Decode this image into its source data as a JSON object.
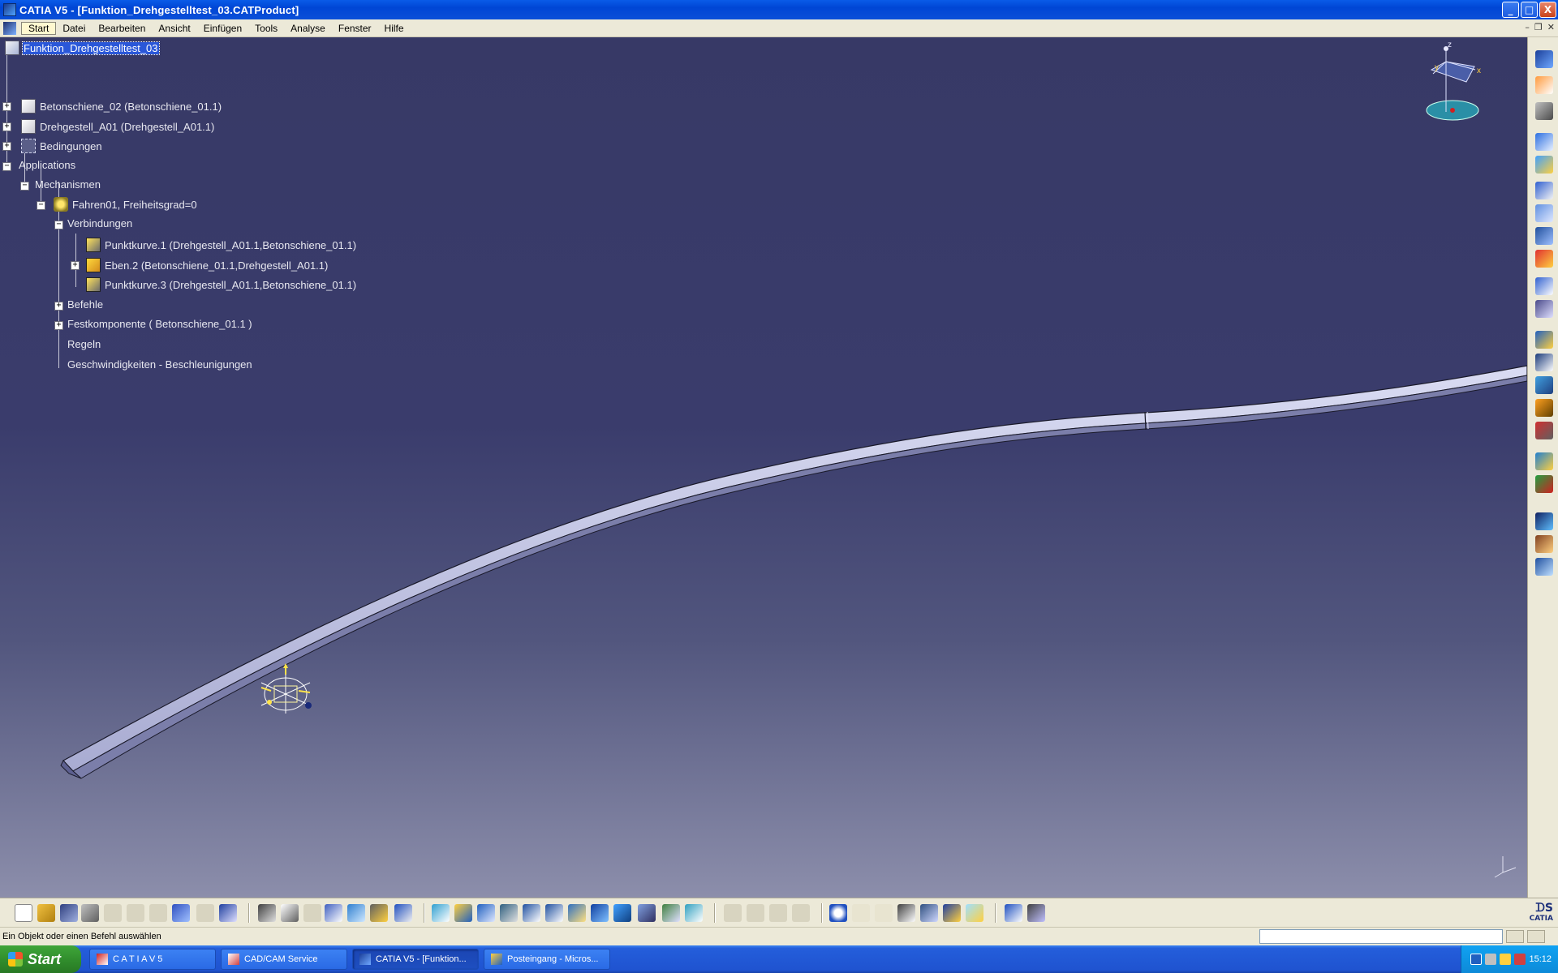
{
  "window": {
    "title": "CATIA V5 - [Funktion_Drehgestelltest_03.CATProduct]",
    "buttons": {
      "minimize": "_",
      "maximize": "□",
      "close": "X"
    }
  },
  "menu": {
    "items": [
      "Start",
      "Datei",
      "Bearbeiten",
      "Ansicht",
      "Einfügen",
      "Tools",
      "Analyse",
      "Fenster",
      "Hilfe"
    ]
  },
  "tree": {
    "root": "Funktion_Drehgestelltest_03",
    "product1": "Betonschiene_02 (Betonschiene_01.1)",
    "product2": "Drehgestell_A01 (Drehgestell_A01.1)",
    "constraints": "Bedingungen",
    "applications": "Applications",
    "mechanisms": "Mechanismen",
    "mechanism1": "Fahren01, Freiheitsgrad=0",
    "joints": "Verbindungen",
    "joint1": "Punktkurve.1 (Drehgestell_A01.1,Betonschiene_01.1)",
    "joint2": "Eben.2 (Betonschiene_01.1,Drehgestell_A01.1)",
    "joint3": "Punktkurve.3 (Drehgestell_A01.1,Betonschiene_01.1)",
    "commands": "Befehle",
    "fixed": "Festkomponente ( Betonschiene_01.1 )",
    "rules": "Regeln",
    "speeds": "Geschwindigkeiten - Beschleunigungen"
  },
  "compass": {
    "axis_z": "z",
    "axis_x": "x",
    "axis_y": "y"
  },
  "status": {
    "message": "Ein Objekt oder einen Befehl auswählen",
    "command_input": ""
  },
  "branding": {
    "logo_text": "CATIA"
  },
  "taskbar": {
    "start": "Start",
    "tasks": [
      "C A T I A  V 5",
      "CAD/CAM Service",
      "CATIA V5 - [Funktion...",
      "Posteingang - Micros..."
    ],
    "clock": "15:12"
  },
  "colors": {
    "viewport_top": "#373966",
    "viewport_bottom": "#8c8eab",
    "rail": "#c5c7e6",
    "selection": "#2a57d8",
    "xp_blue": "#245edb"
  }
}
